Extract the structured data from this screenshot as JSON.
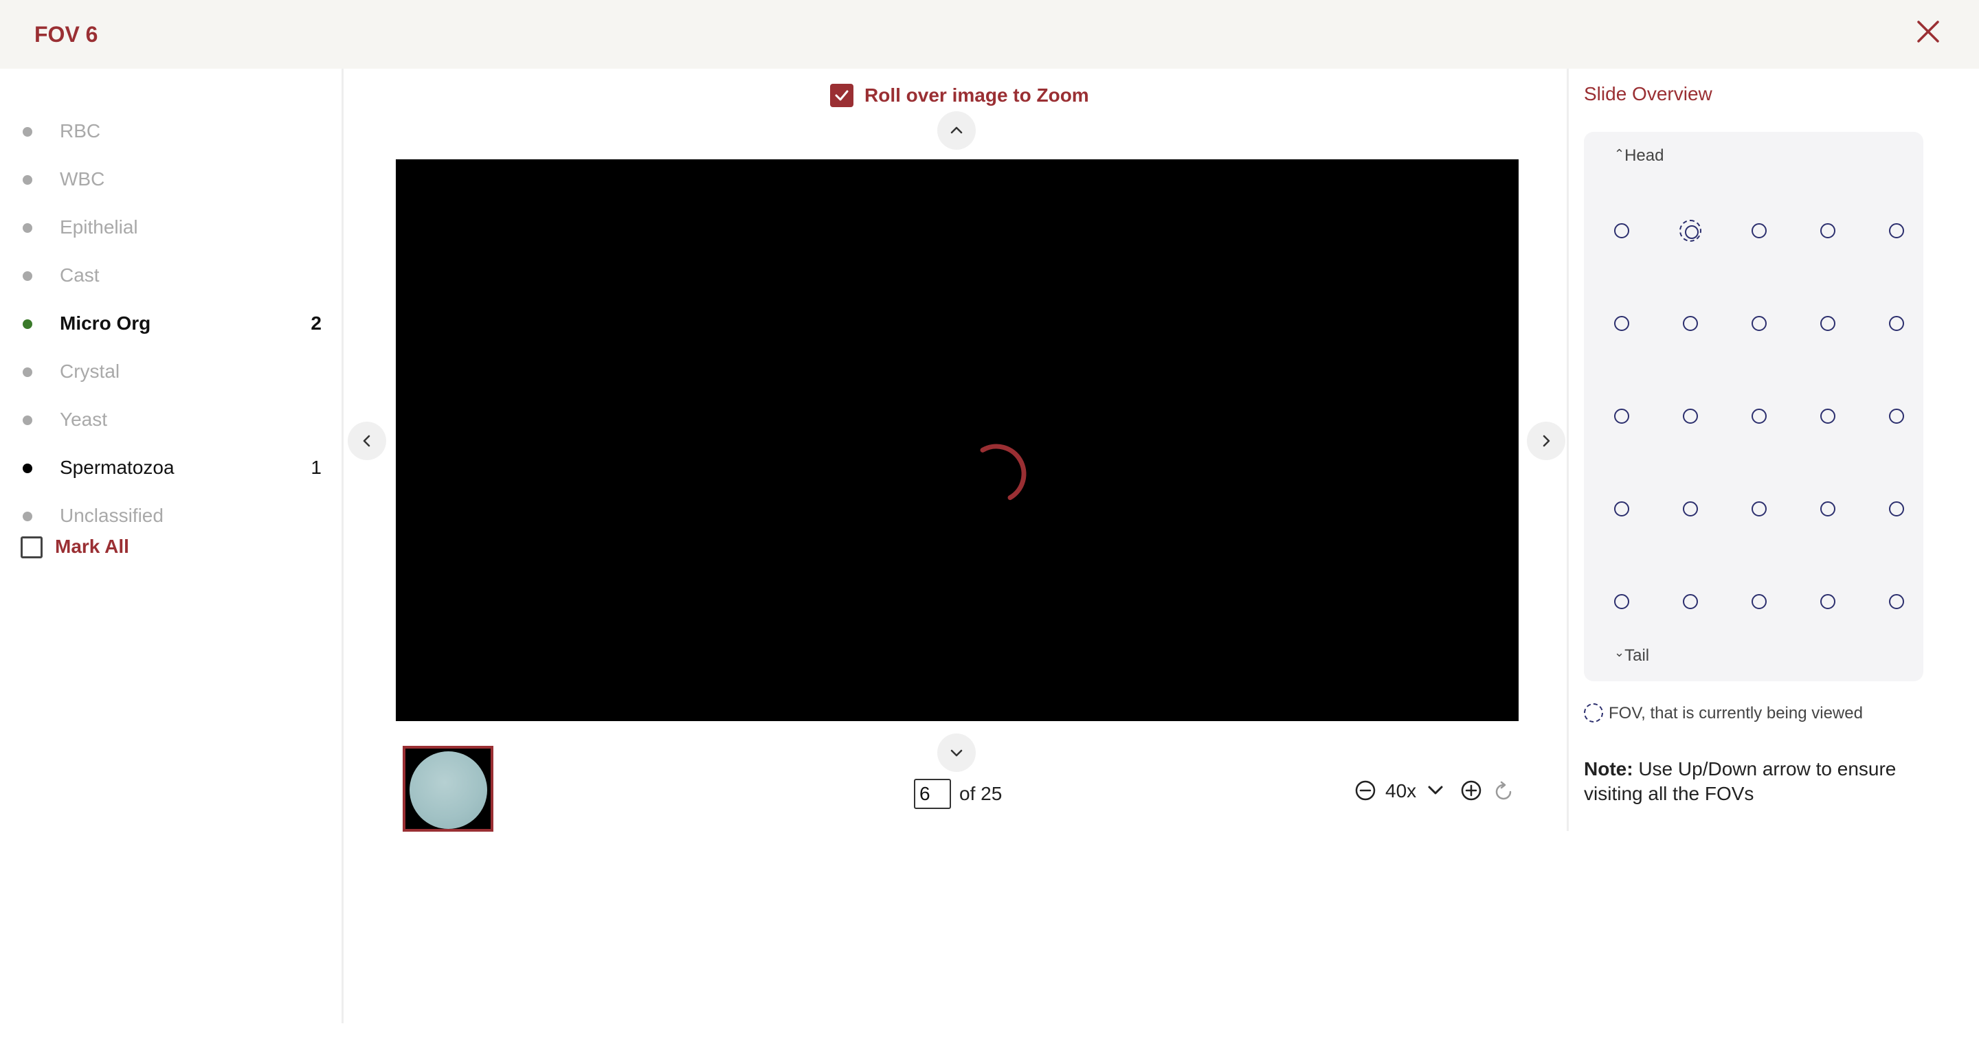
{
  "header": {
    "title": "FOV 6",
    "close_icon": "close-icon"
  },
  "sidebar": {
    "items": [
      {
        "label": "RBC",
        "count": "",
        "state": "inactive"
      },
      {
        "label": "WBC",
        "count": "",
        "state": "inactive"
      },
      {
        "label": "Epithelial",
        "count": "",
        "state": "inactive"
      },
      {
        "label": "Cast",
        "count": "",
        "state": "inactive"
      },
      {
        "label": "Micro Org",
        "count": "2",
        "state": "active"
      },
      {
        "label": "Crystal",
        "count": "",
        "state": "inactive"
      },
      {
        "label": "Yeast",
        "count": "",
        "state": "inactive"
      },
      {
        "label": "Spermatozoa",
        "count": "1",
        "state": "has-count"
      },
      {
        "label": "Unclassified",
        "count": "",
        "state": "inactive"
      }
    ],
    "mark_all_label": "Mark All",
    "mark_all_checked": false
  },
  "viewer": {
    "zoom_toggle_label": "Roll over image to Zoom",
    "zoom_toggle_checked": true,
    "loading": true,
    "page_value": "6",
    "page_total_text": "of 25",
    "zoom_level": "40x"
  },
  "overview": {
    "title": "Slide Overview",
    "head_label": "Head",
    "tail_label": "Tail",
    "grid_rows": 5,
    "grid_cols": 5,
    "current_fov": 2,
    "legend_text": "FOV, that is currently being viewed",
    "note_label": "Note:",
    "note_text": "Use Up/Down arrow to ensure visiting all the FOVs"
  },
  "colors": {
    "brand": "#9a2f33",
    "header_bg": "#f6f5f2",
    "active_dot": "#3a7a2a",
    "muted_text": "#a9a9a9",
    "fov_dot": "#2c2f6e"
  }
}
